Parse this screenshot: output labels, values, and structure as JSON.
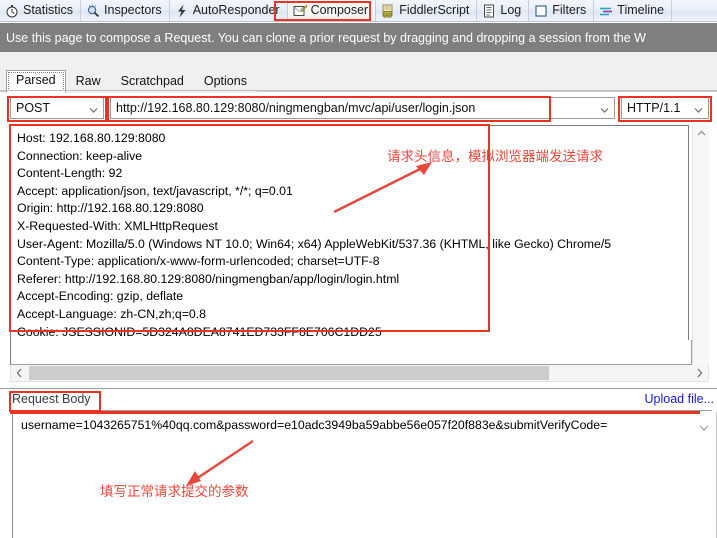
{
  "app": {
    "name": "Fiddler Composer"
  },
  "toolbar": {
    "tabs": [
      {
        "label": "Statistics",
        "icon": "stopwatch-icon",
        "selected": false
      },
      {
        "label": "Inspectors",
        "icon": "magnifier-icon",
        "selected": false
      },
      {
        "label": "AutoResponder",
        "icon": "lightning-icon",
        "selected": false
      },
      {
        "label": "Composer",
        "icon": "compose-pencil-icon",
        "selected": true
      },
      {
        "label": "FiddlerScript",
        "icon": "js-script-icon",
        "selected": false
      },
      {
        "label": "Log",
        "icon": "log-list-icon",
        "selected": false
      },
      {
        "label": "Filters",
        "icon": "filter-checkbox-icon",
        "selected": false
      },
      {
        "label": "Timeline",
        "icon": "timeline-icon",
        "selected": false
      }
    ]
  },
  "banner": {
    "text": "Use this page to compose a Request. You can clone a prior request by dragging and dropping a session from the W"
  },
  "subtabs": {
    "items": [
      {
        "label": "Parsed",
        "active": true
      },
      {
        "label": "Raw",
        "active": false
      },
      {
        "label": "Scratchpad",
        "active": false
      },
      {
        "label": "Options",
        "active": false
      }
    ]
  },
  "request": {
    "method": "POST",
    "url": "http://192.168.80.129:8080/ningmengban/mvc/api/user/login.json",
    "http_version": "HTTP/1.1",
    "headers": [
      "Host: 192.168.80.129:8080",
      "Connection: keep-alive",
      "Content-Length: 92",
      "Accept: application/json, text/javascript, */*; q=0.01",
      "Origin: http://192.168.80.129:8080",
      "X-Requested-With: XMLHttpRequest",
      "User-Agent: Mozilla/5.0 (Windows NT 10.0; Win64; x64) AppleWebKit/537.36 (KHTML, like Gecko) Chrome/5",
      "Content-Type: application/x-www-form-urlencoded; charset=UTF-8",
      "Referer: http://192.168.80.129:8080/ningmengban/app/login/login.html",
      "Accept-Encoding: gzip, deflate",
      "Accept-Language: zh-CN,zh;q=0.8",
      "Cookie: JSESSIONID=5D324A8DEA8741ED733FF8E706C1DD25"
    ]
  },
  "body": {
    "section_label": "Request Body",
    "upload_link": "Upload file...",
    "content": "username=1043265751%40qq.com&password=e10adc3949ba59abbe56e057f20f883e&submitVerifyCode="
  },
  "annotations": [
    {
      "text": "请求头信息，模拟浏览器端发送请求",
      "target": "headers-box"
    },
    {
      "text": "填写正常请求提交的参数",
      "target": "request-body-input"
    }
  ],
  "colors": {
    "highlight_red": "#ea3323",
    "annotation_red": "#e8473c",
    "banner_bg": "#7f7f7f",
    "link_blue": "#1a17d8"
  }
}
